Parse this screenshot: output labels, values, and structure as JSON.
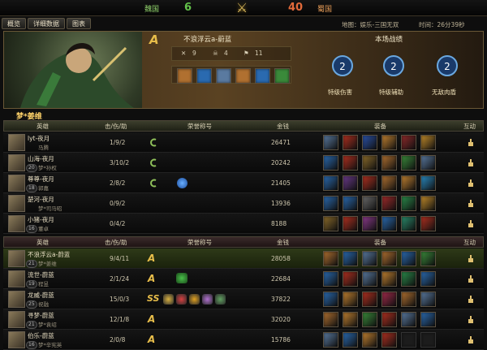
{
  "header": {
    "left_side": "魏国",
    "left_score": "6",
    "right_side": "蜀国",
    "right_score": "40",
    "map_label": "地图：娱乐-三国无双",
    "time_label": "时间：26分39秒"
  },
  "tabs": [
    "概览",
    "详细数据",
    "图表"
  ],
  "hero_panel": {
    "rank": "A",
    "player": "不浪浮云a-蔚蓝",
    "stats": [
      "9",
      "4",
      "11"
    ],
    "achievements_title": "本场战绩",
    "achievements": [
      "特级伤害",
      "特级辅助",
      "无敌肉盾"
    ],
    "hero_name": "梦*姜维"
  },
  "table_headers": {
    "hero": "英雄",
    "kda": "击/伤/助",
    "honor": "荣誉称号",
    "gold": "金钱",
    "equip": "装备",
    "interact": "互动"
  },
  "colors": {
    "team_top": "#3c3e2c",
    "team_bottom": "#3a2a2a",
    "gold": "#e7bd4a"
  },
  "team_top": [
    {
      "name": "lyt-夜月",
      "hero": "马腾",
      "level": "",
      "kda": "1/9/2",
      "gold": "26471",
      "items": [
        "#5a7aa0",
        "#b03020",
        "#2b52a8",
        "#c08030",
        "#8e2a2a",
        "#c08a2a"
      ]
    },
    {
      "name": "山海-夜月",
      "hero": "梦*孙权",
      "level": "20",
      "kda": "3/10/2",
      "gold": "20242",
      "items": [
        "#2a6ab0",
        "#b03020",
        "#8a6a2a",
        "#b07030",
        "#3a8a3a",
        "#5a7aa0"
      ]
    },
    {
      "name": "尊尊-夜月",
      "hero": "郭嘉",
      "level": "18",
      "kda": "2/8/2",
      "gold": "21405",
      "items": [
        "#2a6ab0",
        "#6a3a8a",
        "#b03020",
        "#b07030",
        "#c08030",
        "#2a8ac0"
      ]
    },
    {
      "name": "楚河-夜月",
      "hero": "梦*司马昭",
      "level": "",
      "kda": "0/9/2",
      "gold": "13936",
      "items": [
        "#2a6ab0",
        "#2a6ab0",
        "#6a6a6a",
        "#a02a2a",
        "#2a8a4a",
        "#c08a2a"
      ]
    },
    {
      "name": "小猪-夜月",
      "hero": "董卓",
      "level": "16",
      "kda": "0/4/2",
      "gold": "8188",
      "items": [
        "#8a6a2a",
        "#b03020",
        "#8a3a8a",
        "#2a6ab0",
        "#2a8a6a",
        "#b03020"
      ]
    }
  ],
  "team_bottom": [
    {
      "name": "不浪浮云a-蔚蓝",
      "hero": "梦*姜维",
      "level": "21",
      "kda": "9/4/11",
      "gold": "28058",
      "items": [
        "#b07030",
        "#2a6ab0",
        "#5a7aa0",
        "#b07030",
        "#2a6ab0",
        "#3a8a3a"
      ]
    },
    {
      "name": "流世-蔚蓝",
      "hero": "程昱",
      "level": "19",
      "kda": "2/1/24",
      "gold": "22684",
      "items": [
        "#2a6ab0",
        "#b03020",
        "#5a7aa0",
        "#c08030",
        "#2a8a4a",
        "#2a6ab0"
      ]
    },
    {
      "name": "龙威-蔚蓝",
      "hero": "祝融",
      "level": "25",
      "kda": "15/0/3",
      "gold": "37822",
      "items": [
        "#2a6ab0",
        "#c08030",
        "#b03020",
        "#a02a4a",
        "#b07030",
        "#5a7aa0"
      ]
    },
    {
      "name": "寻梦-蔚蓝",
      "hero": "梦*袁绍",
      "level": "21",
      "kda": "12/1/8",
      "gold": "32020",
      "items": [
        "#b07030",
        "#c08030",
        "#3a8a3a",
        "#b03020",
        "#5a7aa0",
        "#2a6ab0"
      ]
    },
    {
      "name": "伯乐-蔚蓝",
      "hero": "梦*辛宪英",
      "level": "16",
      "kda": "2/0/8",
      "gold": "15786",
      "items": [
        "#5a7aa0",
        "#2a6ab0",
        "#c08030",
        "#b03020",
        "",
        ""
      ]
    }
  ]
}
